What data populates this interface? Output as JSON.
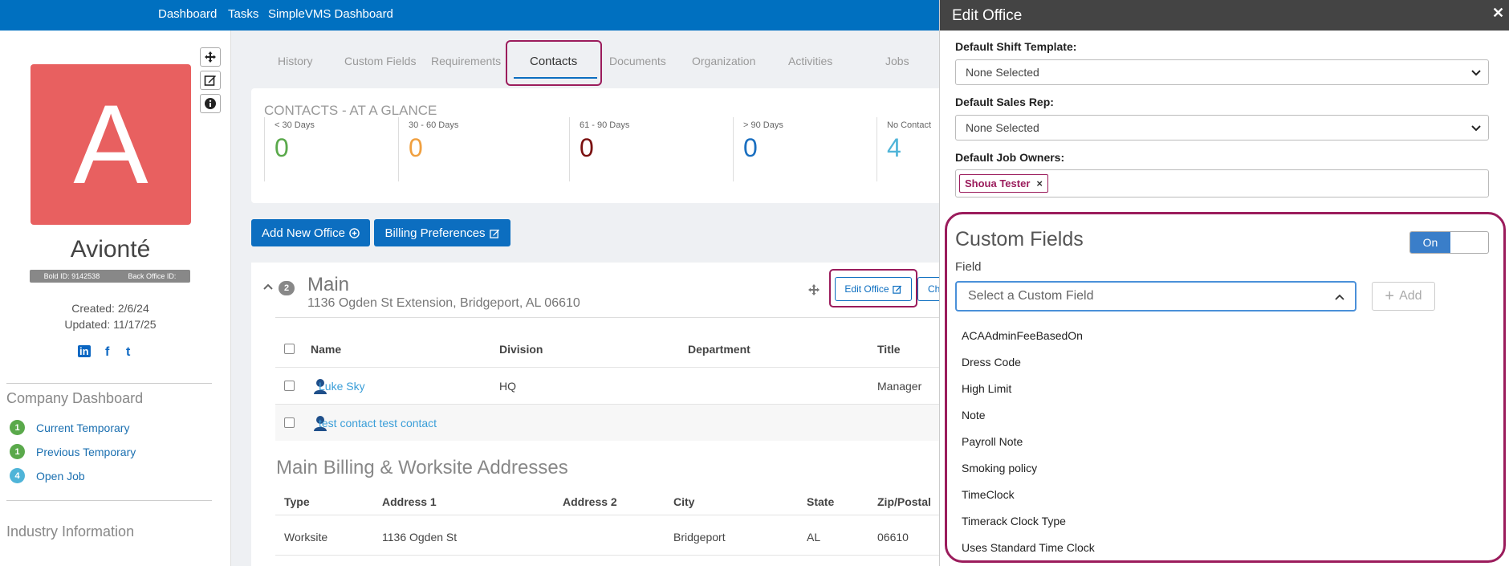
{
  "topnav": {
    "links": [
      "Dashboard",
      "Tasks",
      "SimpleVMS Dashboard"
    ]
  },
  "left": {
    "avatar_letter": "A",
    "company_name": "Avionté",
    "bold_id": "Bold ID: 9142538",
    "back_office_id": "Back Office ID:",
    "created": "Created: 2/6/24",
    "updated": "Updated: 11/17/25",
    "social": [
      "in",
      "f",
      "t"
    ],
    "dashboard_title": "Company Dashboard",
    "dashboard_items": [
      {
        "count": "1",
        "label": "Current Temporary",
        "color": "#5aa94b"
      },
      {
        "count": "1",
        "label": "Previous Temporary",
        "color": "#5aa94b"
      },
      {
        "count": "4",
        "label": "Open Job",
        "color": "#4fb4d8"
      }
    ],
    "industry_title": "Industry Information"
  },
  "tabs": [
    "History",
    "Custom Fields",
    "Requirements",
    "Contacts",
    "Documents",
    "Organization",
    "Activities",
    "Jobs"
  ],
  "glance": {
    "title": "CONTACTS - AT A GLANCE",
    "stats": [
      {
        "label": "< 30 Days",
        "value": "0",
        "color": "#5aa94b"
      },
      {
        "label": "30 - 60 Days",
        "value": "0",
        "color": "#f0a040"
      },
      {
        "label": "61 - 90 Days",
        "value": "0",
        "color": "#7a1010"
      },
      {
        "label": "> 90 Days",
        "value": "0",
        "color": "#1a6fc0"
      },
      {
        "label": "No Contact",
        "value": "4",
        "color": "#4fb4d8"
      }
    ]
  },
  "buttons": {
    "add_office": "Add New Office",
    "billing": "Billing Preferences"
  },
  "office": {
    "count": "2",
    "name": "Main",
    "address": "1136 Ogden St Extension, Bridgeport, AL 06610",
    "edit_office": "Edit Office",
    "child_partial": "Chil",
    "columns": [
      "Name",
      "Division",
      "Department",
      "Title"
    ],
    "contacts": [
      {
        "name": "Luke Sky",
        "division": "HQ",
        "department": "",
        "title": "Manager"
      },
      {
        "name": "test contact test contact",
        "division": "",
        "department": "",
        "title": ""
      }
    ],
    "addresses_title": "Main Billing & Worksite Addresses",
    "addr_columns": [
      "Type",
      "Address 1",
      "Address 2",
      "City",
      "State",
      "Zip/Postal"
    ],
    "addr_rows": [
      {
        "type": "Worksite",
        "address1": "1136 Ogden St",
        "address2": "",
        "city": "Bridgeport",
        "state": "AL",
        "zip": "06610"
      }
    ]
  },
  "panel": {
    "title": "Edit Office",
    "shift_label": "Default Shift Template:",
    "shift_value": "None Selected",
    "sales_label": "Default Sales Rep:",
    "sales_value": "None Selected",
    "owners_label": "Default Job Owners:",
    "owner_tag": "Shoua Tester",
    "cf_title": "Custom Fields",
    "toggle_on": "On",
    "field_label": "Field",
    "select_placeholder": "Select a Custom Field",
    "add_label": "Add",
    "options": [
      "ACAAdminFeeBasedOn",
      "Dress Code",
      "High Limit",
      "Note",
      "Payroll Note",
      "Smoking policy",
      "TimeClock",
      "Timerack Clock Type",
      "Uses Standard Time Clock"
    ]
  },
  "colors": {
    "accent": "#0c6ec0",
    "highlight": "#9b1c5c",
    "header": "#0070c0"
  }
}
